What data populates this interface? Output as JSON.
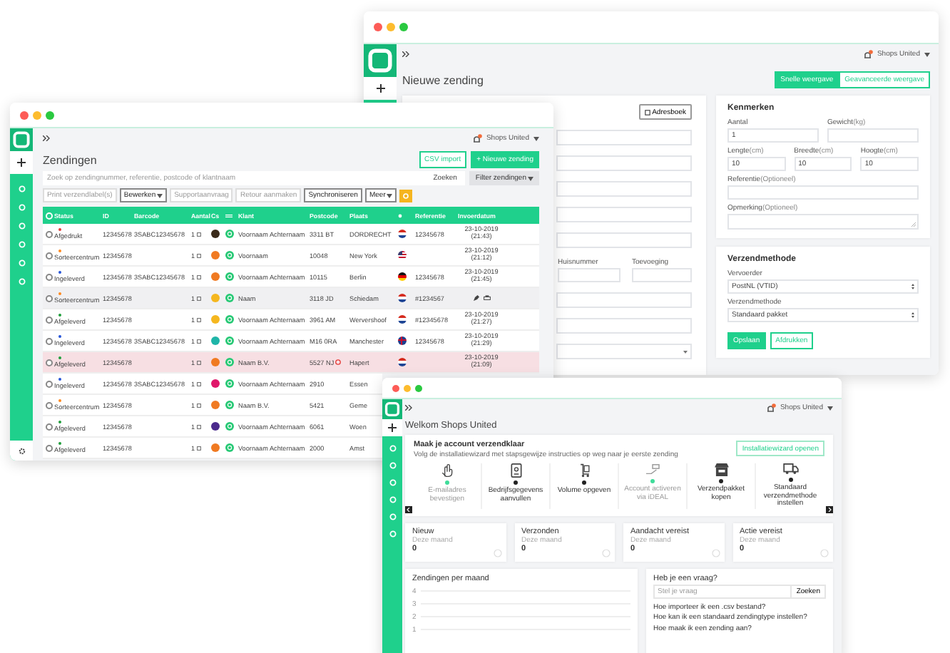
{
  "new_shipment_window": {
    "account": "Shops United",
    "page_title": "Nieuwe zending",
    "view_toggle": [
      {
        "label": "Snelle weergave",
        "selected": true
      },
      {
        "label": "Geavanceerde weergave",
        "selected": false
      }
    ],
    "address_book_button": "Adresboek",
    "address_inline_labels": [
      "Huisnummer",
      "Toevoeging"
    ],
    "kenmerken": {
      "title": "Kenmerken",
      "rows": [
        [
          {
            "label": "Aantal",
            "value": "1"
          },
          {
            "label": "Gewicht",
            "unit": "(kg)"
          }
        ],
        [
          {
            "label": "Lengte",
            "unit": "(cm)",
            "value": "10"
          },
          {
            "label": "Breedte",
            "unit": "(cm)",
            "value": "10"
          },
          {
            "label": "Hoogte",
            "unit": "(cm)",
            "value": "10"
          }
        ],
        [
          {
            "label": "Referentie",
            "unit": "(Optioneel)"
          }
        ],
        [
          {
            "label": "Opmerking",
            "unit": "(Optioneel)",
            "kind": "textarea"
          }
        ]
      ]
    },
    "shipping": {
      "title": "Verzendmethode",
      "selects": [
        {
          "label": "Vervoerder",
          "value": "PostNL (VTID)"
        },
        {
          "label": "Verzendmethode",
          "value": "Standaard pakket"
        }
      ],
      "buttons": [
        {
          "label": "Opslaan",
          "primary": true
        },
        {
          "label": "Afdrukken",
          "primary": false
        }
      ]
    }
  },
  "shipments_window": {
    "account": "Shops United",
    "page_title": "Zendingen",
    "csv_button": "CSV import",
    "new_button": "+ Nieuwe zending",
    "search": {
      "placeholder": "Zoek op zendingnummer, referentie, postcode of klantnaam",
      "button": "Zoeken"
    },
    "filter_button": "Filter zendingen",
    "actions": [
      {
        "label": "Print verzendlabel(s)",
        "dropdown": false,
        "strong": false
      },
      {
        "label": "Bewerken",
        "dropdown": true,
        "strong": true
      },
      {
        "label": "Supportaanvraag",
        "dropdown": false,
        "strong": false
      },
      {
        "label": "Retour aanmaken",
        "dropdown": false,
        "strong": false
      },
      {
        "label": "Synchroniseren",
        "dropdown": false,
        "strong": true
      },
      {
        "label": "Meer",
        "dropdown": true,
        "strong": true
      }
    ],
    "select_all": {
      "checked": false
    },
    "columns": [
      "Status",
      "ID",
      "Barcode",
      "Aantal",
      "Cs",
      "Klant",
      "Postcode",
      "Plaats",
      "Referentie",
      "Invoerdatum"
    ],
    "rows": [
      {
        "checked": false,
        "status": "Afgedrukt",
        "color": "#e53935",
        "id": "12345678",
        "barcode": "3SABC12345678",
        "quantity": "1",
        "carrier": {
          "color": "#3a2a1a"
        },
        "klant": "Voornaam Achternaam",
        "postcode": "3311 BT",
        "plaats": "DORDRECHT",
        "flag": {
          "kind": "nl"
        },
        "referentie": "12345678",
        "date": "23-10-2019",
        "time": "(21:43)",
        "hovered": false,
        "error": false,
        "postcode_warning": false
      },
      {
        "checked": false,
        "status": "Sorteercentrum",
        "color": "#ff8a1f",
        "id": "12345678",
        "quantity": "1",
        "carrier": {
          "color": "#f07a22"
        },
        "klant": "Voornaam",
        "postcode": "10048",
        "plaats": "New York",
        "flag": {
          "kind": "us"
        },
        "date": "23-10-2019",
        "time": "(21:12)",
        "hovered": false,
        "error": false,
        "postcode_warning": false
      },
      {
        "checked": false,
        "status": "Ingeleverd",
        "color": "#2856d8",
        "id": "12345678",
        "barcode": "3SABC12345678",
        "quantity": "1",
        "carrier": {
          "color": "#f07a22"
        },
        "klant": "Voornaam Achternaam",
        "postcode": "10115",
        "plaats": "Berlin",
        "flag": {
          "kind": "de"
        },
        "referentie": "12345678",
        "date": "23-10-2019",
        "time": "(21:45)",
        "hovered": false,
        "error": false,
        "postcode_warning": false
      },
      {
        "checked": false,
        "status": "Sorteercentrum",
        "color": "#ff8a1f",
        "id": "12345678",
        "quantity": "1",
        "carrier": {
          "color": "#f5b71f"
        },
        "klant": "Naam",
        "postcode": "3118 JD",
        "plaats": "Schiedam",
        "flag": {
          "kind": "nl"
        },
        "referentie": "#1234567",
        "hovered": true,
        "error": false,
        "postcode_warning": false
      },
      {
        "checked": false,
        "status": "Afgeleverd",
        "color": "#1e9e3a",
        "id": "12345678",
        "quantity": "1",
        "carrier": {
          "color": "#f5b71f"
        },
        "klant": "Voornaam Achternaam",
        "postcode": "3961 AM",
        "plaats": "Wervershoof",
        "flag": {
          "kind": "nl"
        },
        "referentie": "#12345678",
        "date": "23-10-2019",
        "time": "(21:27)",
        "hovered": false,
        "error": false,
        "postcode_warning": false
      },
      {
        "checked": false,
        "status": "Ingeleverd",
        "color": "#2856d8",
        "id": "12345678",
        "barcode": "3SABC12345678",
        "quantity": "1",
        "carrier": {
          "color": "#1fb5a8"
        },
        "klant": "Voornaam Achternaam",
        "postcode": "M16 0RA",
        "plaats": "Manchester",
        "flag": {
          "kind": "gb"
        },
        "referentie": "12345678",
        "date": "23-10-2019",
        "time": "(21:29)",
        "hovered": false,
        "error": false,
        "postcode_warning": false
      },
      {
        "checked": false,
        "status": "Afgeleverd",
        "color": "#1e9e3a",
        "id": "12345678",
        "quantity": "1",
        "carrier": {
          "color": "#f07a22"
        },
        "klant": "Naam B.V.",
        "postcode": "5527 NJ",
        "plaats": "Hapert",
        "flag": {
          "kind": "nl"
        },
        "date": "23-10-2019",
        "time": "(21:09)",
        "hovered": false,
        "error": true,
        "postcode_warning": true
      },
      {
        "checked": false,
        "status": "Ingeleverd",
        "color": "#2856d8",
        "id": "12345678",
        "barcode": "3SABC12345678",
        "quantity": "1",
        "carrier": {
          "color": "#e0176a"
        },
        "klant": "Voornaam Achternaam",
        "postcode": "2910",
        "plaats": "Essen",
        "hovered": false,
        "error": false,
        "postcode_warning": false
      },
      {
        "checked": false,
        "status": "Sorteercentrum",
        "color": "#ff8a1f",
        "id": "12345678",
        "quantity": "1",
        "carrier": {
          "color": "#f07a22"
        },
        "klant": "Naam B.V.",
        "postcode": "5421",
        "plaats": "Geme",
        "hovered": false,
        "error": false,
        "postcode_warning": false
      },
      {
        "checked": false,
        "status": "Afgeleverd",
        "color": "#1e9e3a",
        "id": "12345678",
        "quantity": "1",
        "carrier": {
          "color": "#4b2a8c"
        },
        "klant": "Voornaam Achternaam",
        "postcode": "6061",
        "plaats": "Woen",
        "hovered": false,
        "error": false,
        "postcode_warning": false
      },
      {
        "checked": false,
        "status": "Afgeleverd",
        "color": "#1e9e3a",
        "id": "12345678",
        "quantity": "1",
        "carrier": {
          "color": "#f07a22"
        },
        "klant": "Voornaam Achternaam",
        "postcode": "2000",
        "plaats": "Amst",
        "hovered": false,
        "error": false,
        "postcode_warning": false
      }
    ]
  },
  "dashboard_window": {
    "account": "Shops United",
    "page_title": "Welkom Shops United",
    "setup": {
      "title": "Maak je account verzendklaar",
      "subtitle": "Volg de installatiewizard met stapsgewijze instructies op weg naar je eerste zending",
      "button": "Installatiewizard openen",
      "steps": [
        {
          "label": "E-mailadres bevestigen",
          "done": true
        },
        {
          "label": "Bedrijfsgegevens aanvullen",
          "done": false
        },
        {
          "label": "Volume opgeven",
          "done": false
        },
        {
          "label": "Account activeren via iDEAL",
          "done": true
        },
        {
          "label": "Verzendpakket kopen",
          "done": false
        },
        {
          "label": "Standaard verzendmethode instellen",
          "done": false
        }
      ]
    },
    "stats": [
      {
        "title": "Nieuw",
        "subtitle": "Deze maand",
        "value": "0"
      },
      {
        "title": "Verzonden",
        "subtitle": "Deze maand",
        "value": "0"
      },
      {
        "title": "Aandacht vereist",
        "subtitle": "Deze maand",
        "value": "0"
      },
      {
        "title": "Actie vereist",
        "subtitle": "Deze maand",
        "value": "0"
      }
    ],
    "chart": {
      "title": "Zendingen per maand",
      "y_tick_labels": [
        "4",
        "3",
        "2",
        "1"
      ]
    },
    "help": {
      "title": "Heb je een vraag?",
      "placeholder": "Stel je vraag",
      "button": "Zoeken",
      "links": [
        "Hoe importeer ik een .csv bestand?",
        "Hoe kan ik een standaard zendingtype instellen?",
        "Hoe maak ik een zending aan?"
      ]
    }
  }
}
